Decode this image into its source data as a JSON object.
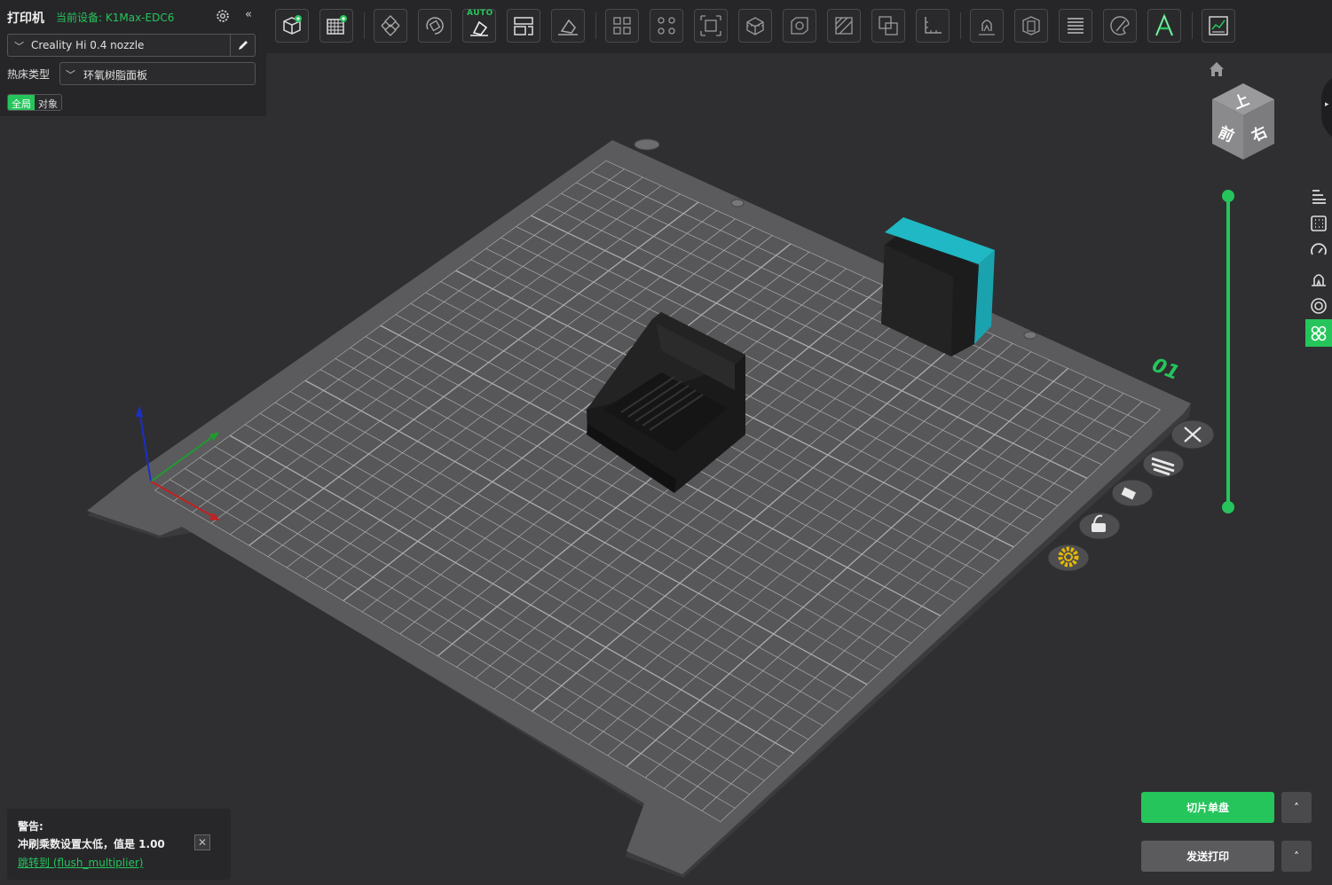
{
  "left_panel": {
    "title": "打印机",
    "device": "当前设备: K1Max-EDC6",
    "nozzle": "Creality Hi 0.4 nozzle",
    "bed_label": "热床类型",
    "bed_type": "环氧树脂面板",
    "tabs": [
      "全局",
      "对象"
    ]
  },
  "toolbar": {
    "auto_label": "AUTO",
    "icons": [
      "add-object-icon",
      "add-plate-icon",
      "arrange-icon",
      "orient-icon",
      "auto-orient-icon",
      "align-icon",
      "lay-on-face-icon",
      "split-objects-icon",
      "split-parts-icon",
      "scale-icon",
      "cut-icon",
      "hollow-icon",
      "support-paint-icon",
      "boolean-icon",
      "measure-icon",
      "seam-paint-icon",
      "layer-icon",
      "variable-layer-icon",
      "color-paint-icon",
      "text-icon",
      "assembly-icon"
    ]
  },
  "plate": {
    "number": "01"
  },
  "actions": {
    "slice_label": "切片单盘",
    "send_label": "发送打印",
    "caret": "˄"
  },
  "warning": {
    "title": "警告:",
    "body": "冲刷乘数设置太低，值是 1.00",
    "link": "跳转到 (flush_multiplier)"
  },
  "view_cube": {
    "top": "上",
    "front": "前",
    "right": "右"
  },
  "right_tools": [
    "layers-list-icon",
    "plate-settings-icon",
    "speed-icon",
    "support-icon",
    "seam-icon",
    "object-list-icon"
  ],
  "colors": {
    "accent": "#25c55b",
    "cyan_object": "#1fb8c4",
    "bed": "#5a5a5c"
  }
}
